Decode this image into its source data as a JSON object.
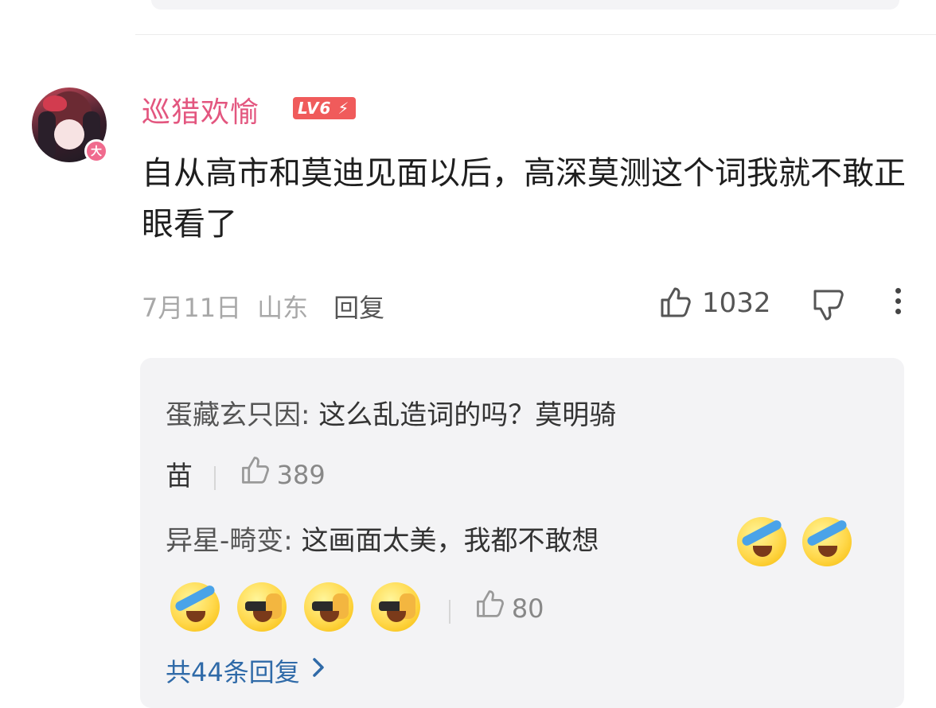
{
  "comment": {
    "username": "巡猎欢愉",
    "level": "LV6",
    "avatar_badge": "大",
    "text": "自从高市和莫迪见面以后，高深莫测这个词我就不敢正眼看了",
    "date": "7月11日",
    "location": "山东",
    "reply_label": "回复",
    "likes": "1032"
  },
  "replies": [
    {
      "name": "蛋藏玄只因:",
      "text_line1": "这么乱造词的吗？莫明骑",
      "text_line2": "苗",
      "likes": "389"
    },
    {
      "name": "异星-畸变:",
      "text": "这画面太美，我都不敢想",
      "likes": "80"
    }
  ],
  "more_replies": "共44条回复",
  "colors": {
    "username": "#e3567f",
    "level_badge": "#f05b5b",
    "link": "#2f6aa8"
  }
}
